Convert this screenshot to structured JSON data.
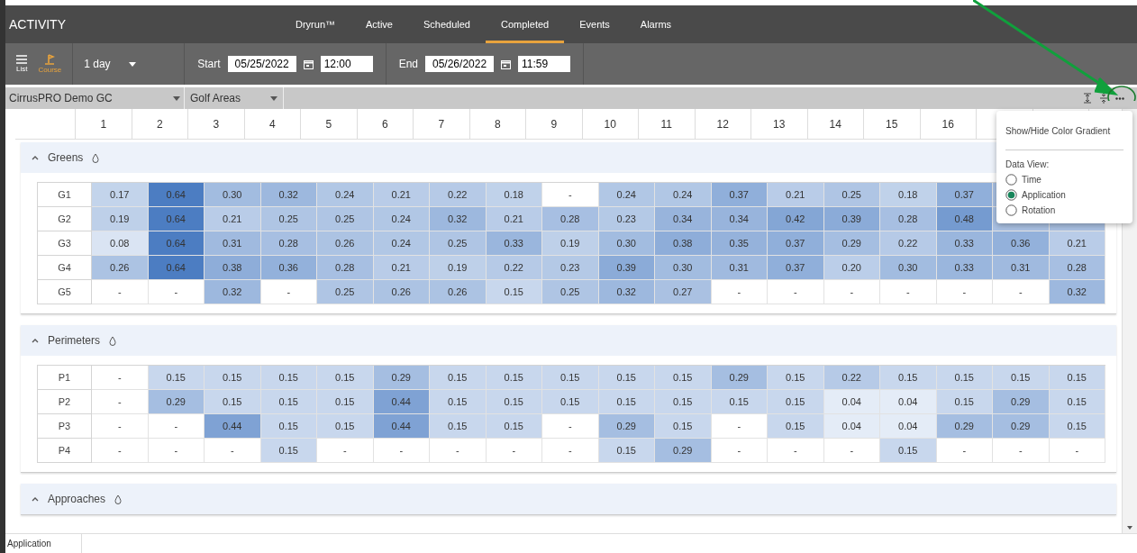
{
  "header": {
    "title": "ACTIVITY",
    "tabs": [
      {
        "label": "Dryrun™",
        "selected": false
      },
      {
        "label": "Active",
        "selected": false
      },
      {
        "label": "Scheduled",
        "selected": false
      },
      {
        "label": "Completed",
        "selected": true
      },
      {
        "label": "Events",
        "selected": false
      },
      {
        "label": "Alarms",
        "selected": false
      }
    ]
  },
  "toolbar": {
    "views": [
      {
        "label": "List",
        "selected": false
      },
      {
        "label": "Course",
        "selected": true
      }
    ],
    "range": "1 day",
    "start_label": "Start",
    "start_date": "05/25/2022",
    "start_time": "12:00",
    "end_label": "End",
    "end_date": "05/26/2022",
    "end_time": "11:59"
  },
  "filters": [
    {
      "value": "CirrusPRO Demo GC"
    },
    {
      "value": "Golf Areas"
    }
  ],
  "columns": [
    "1",
    "2",
    "3",
    "4",
    "5",
    "6",
    "7",
    "8",
    "9",
    "10",
    "11",
    "12",
    "13",
    "14",
    "15",
    "16"
  ],
  "sections": [
    {
      "title": "Greens",
      "rows": [
        {
          "label": "G1",
          "values": [
            "0.17",
            "0.64",
            "0.30",
            "0.32",
            "0.24",
            "0.21",
            "0.22",
            "0.18",
            "-",
            "0.24",
            "0.24",
            "0.37",
            "0.21",
            "0.25",
            "0.18",
            "0.37"
          ]
        },
        {
          "label": "G2",
          "values": [
            "0.19",
            "0.64",
            "0.21",
            "0.25",
            "0.25",
            "0.24",
            "0.32",
            "0.21",
            "0.28",
            "0.23",
            "0.34",
            "0.34",
            "0.42",
            "0.39",
            "0.28",
            "0.48"
          ]
        },
        {
          "label": "G3",
          "values": [
            "0.08",
            "0.64",
            "0.31",
            "0.28",
            "0.26",
            "0.24",
            "0.25",
            "0.33",
            "0.19",
            "0.30",
            "0.38",
            "0.35",
            "0.37",
            "0.29",
            "0.22",
            "0.33",
            "0.36",
            "0.21"
          ]
        },
        {
          "label": "G4",
          "values": [
            "0.26",
            "0.64",
            "0.38",
            "0.36",
            "0.28",
            "0.21",
            "0.19",
            "0.22",
            "0.23",
            "0.39",
            "0.30",
            "0.31",
            "0.37",
            "0.20",
            "0.30",
            "0.33",
            "0.31",
            "0.28"
          ]
        },
        {
          "label": "G5",
          "values": [
            "-",
            "-",
            "0.32",
            "-",
            "0.25",
            "0.26",
            "0.26",
            "0.15",
            "0.25",
            "0.32",
            "0.27",
            "-",
            "-",
            "-",
            "-",
            "-",
            "-",
            "0.32"
          ]
        }
      ]
    },
    {
      "title": "Perimeters",
      "rows": [
        {
          "label": "P1",
          "values": [
            "-",
            "0.15",
            "0.15",
            "0.15",
            "0.15",
            "0.29",
            "0.15",
            "0.15",
            "0.15",
            "0.15",
            "0.15",
            "0.29",
            "0.15",
            "0.22",
            "0.15",
            "0.15",
            "0.15",
            "0.15"
          ]
        },
        {
          "label": "P2",
          "values": [
            "-",
            "0.29",
            "0.15",
            "0.15",
            "0.15",
            "0.44",
            "0.15",
            "0.15",
            "0.15",
            "0.15",
            "0.15",
            "0.15",
            "0.15",
            "0.04",
            "0.04",
            "0.15",
            "0.29",
            "0.15"
          ]
        },
        {
          "label": "P3",
          "values": [
            "-",
            "-",
            "0.44",
            "0.15",
            "0.15",
            "0.44",
            "0.15",
            "0.15",
            "-",
            "0.29",
            "0.15",
            "-",
            "0.15",
            "0.04",
            "0.04",
            "0.29",
            "0.29",
            "0.15"
          ]
        },
        {
          "label": "P4",
          "values": [
            "-",
            "-",
            "-",
            "0.15",
            "-",
            "-",
            "-",
            "-",
            "-",
            "0.15",
            "0.29",
            "-",
            "-",
            "-",
            "0.15",
            "-",
            "-",
            "-"
          ]
        }
      ]
    },
    {
      "title": "Approaches"
    }
  ],
  "menu": {
    "items": [
      {
        "label": "Show/Hide Color Gradient"
      }
    ],
    "data_view_label": "Data View:",
    "options": [
      {
        "label": "Time",
        "selected": false
      },
      {
        "label": "Application",
        "selected": true
      },
      {
        "label": "Rotation",
        "selected": false
      }
    ]
  },
  "status_bar": {
    "label": "Application"
  }
}
